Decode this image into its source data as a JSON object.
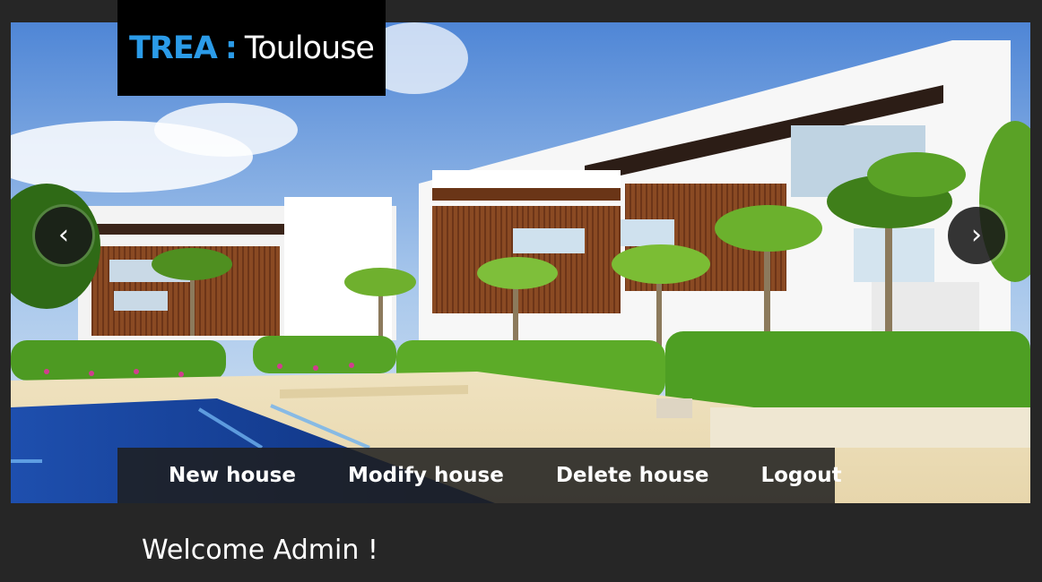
{
  "header": {
    "brand": "TREA",
    "separator": ":",
    "city": "Toulouse"
  },
  "slider": {
    "prev_icon": "‹",
    "next_icon": "›"
  },
  "menu": {
    "items": [
      {
        "label": "New house"
      },
      {
        "label": "Modify house"
      },
      {
        "label": "Delete house"
      },
      {
        "label": "Logout"
      }
    ]
  },
  "main": {
    "welcome": "Welcome Admin !"
  },
  "colors": {
    "background": "#262626",
    "brand_blue": "#2b9be8",
    "logo_bg": "#000000"
  }
}
